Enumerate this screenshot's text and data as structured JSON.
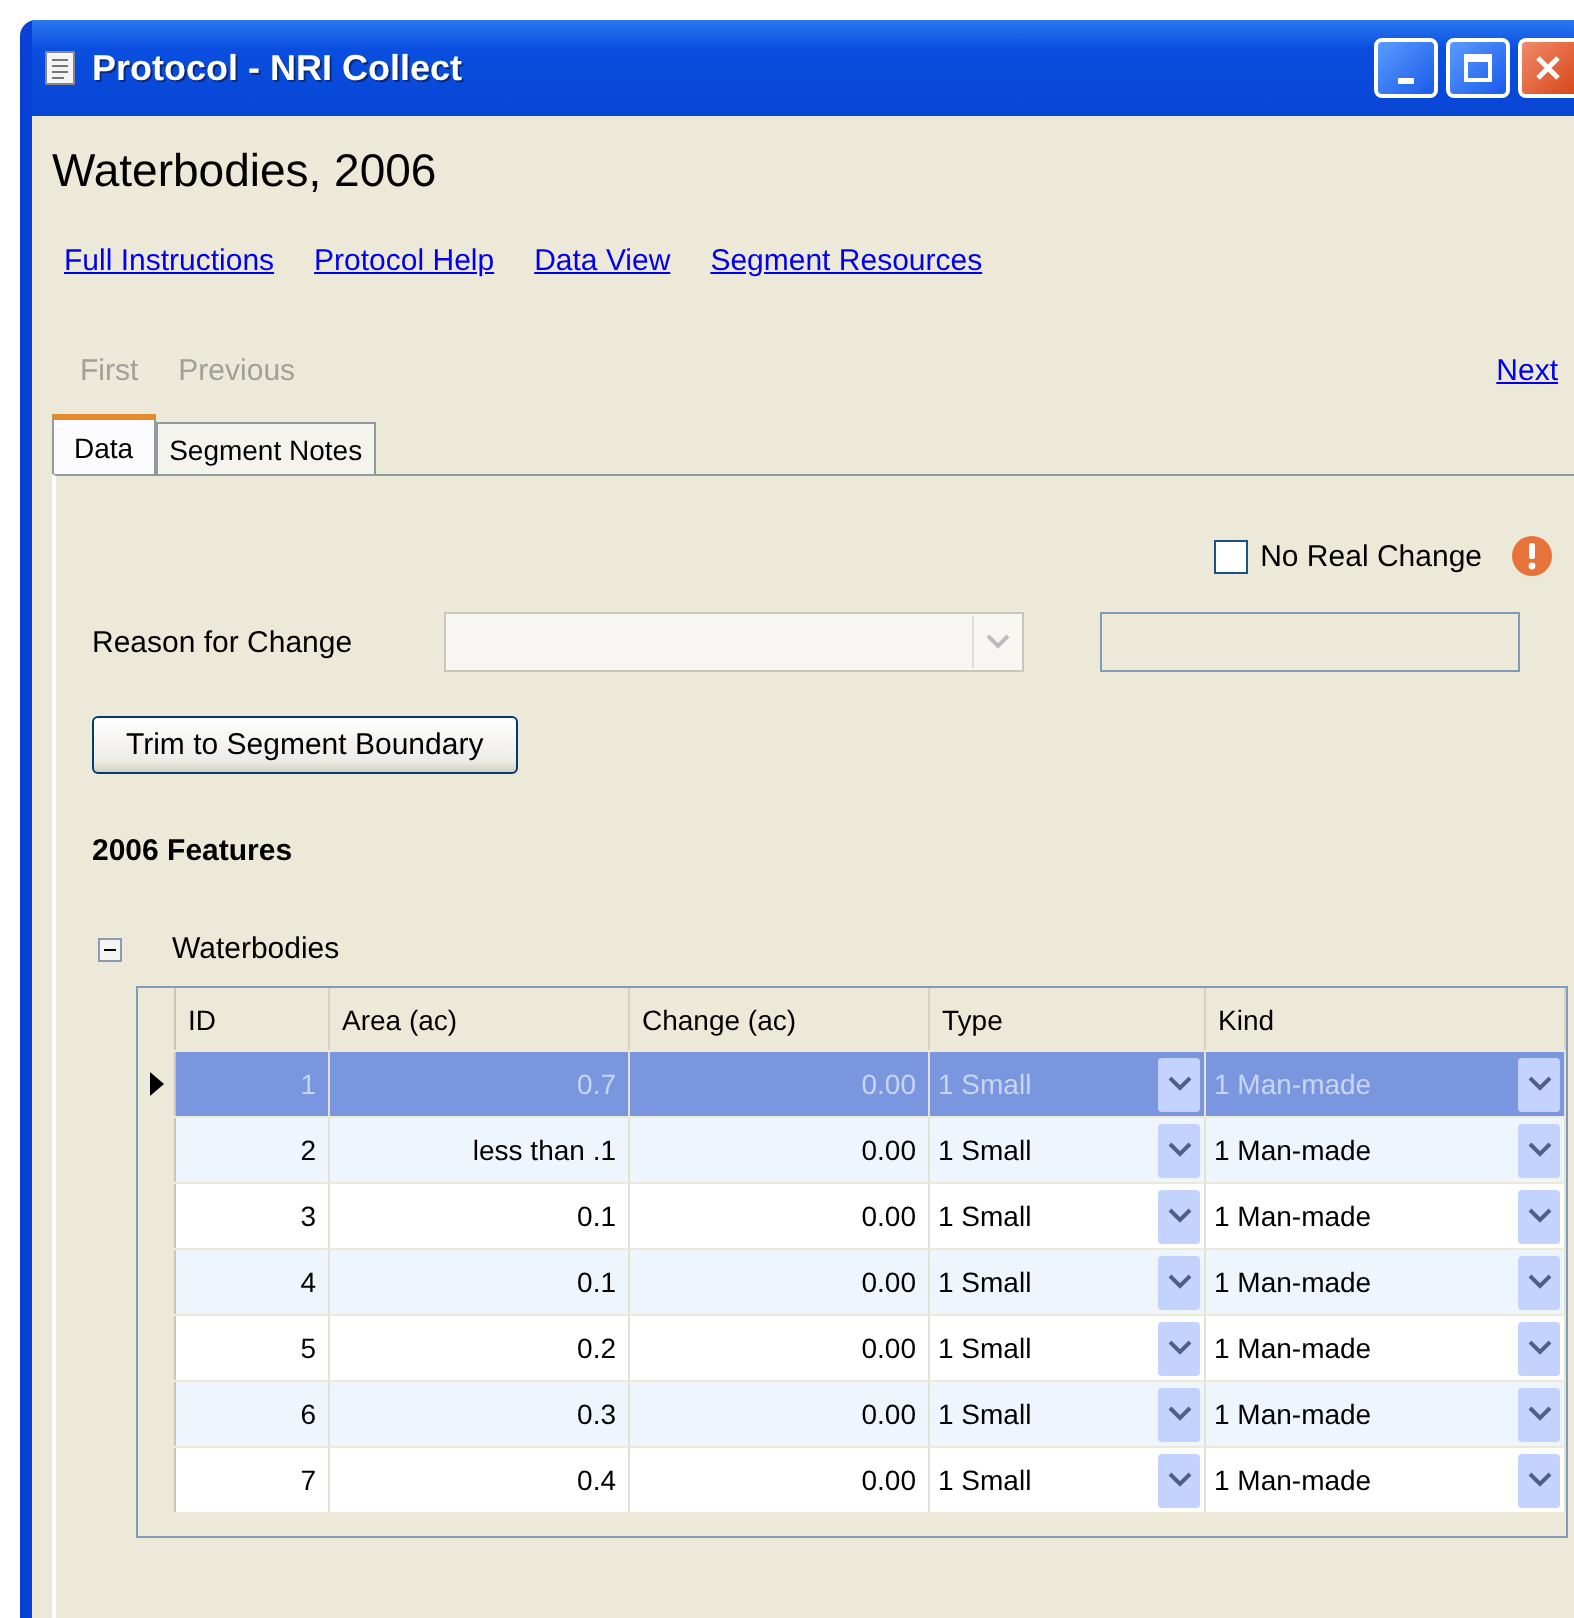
{
  "window": {
    "title": "Protocol - NRI Collect"
  },
  "heading": "Waterbodies, 2006",
  "links": [
    "Full Instructions",
    "Protocol Help",
    "Data View",
    "Segment Resources"
  ],
  "nav": [
    {
      "label": "First",
      "disabled": true
    },
    {
      "label": "Previous",
      "disabled": true
    },
    {
      "label": "Next",
      "disabled": false
    }
  ],
  "tabs": [
    {
      "label": "Data",
      "selected": true
    },
    {
      "label": "Segment Notes",
      "selected": false
    }
  ],
  "no_real_change": {
    "label": "No Real Change",
    "checked": false
  },
  "reason": {
    "label": "Reason for Change",
    "disabled": true
  },
  "trim_button": "Trim to Segment Boundary",
  "section_title": "2006 Features",
  "group": {
    "label": "Waterbodies",
    "expanded": true
  },
  "table": {
    "columns": [
      "ID",
      "Area (ac)",
      "Change (ac)",
      "Type",
      "Kind"
    ],
    "rows": [
      {
        "id": "1",
        "area": "0.7",
        "change": "0.00",
        "type": "1 Small",
        "kind": "1 Man-made",
        "selected": true
      },
      {
        "id": "2",
        "area": "less than .1",
        "change": "0.00",
        "type": "1 Small",
        "kind": "1 Man-made",
        "selected": false
      },
      {
        "id": "3",
        "area": "0.1",
        "change": "0.00",
        "type": "1 Small",
        "kind": "1 Man-made",
        "selected": false
      },
      {
        "id": "4",
        "area": "0.1",
        "change": "0.00",
        "type": "1 Small",
        "kind": "1 Man-made",
        "selected": false
      },
      {
        "id": "5",
        "area": "0.2",
        "change": "0.00",
        "type": "1 Small",
        "kind": "1 Man-made",
        "selected": false
      },
      {
        "id": "6",
        "area": "0.3",
        "change": "0.00",
        "type": "1 Small",
        "kind": "1 Man-made",
        "selected": false
      },
      {
        "id": "7",
        "area": "0.4",
        "change": "0.00",
        "type": "1 Small",
        "kind": "1 Man-made",
        "selected": false
      }
    ]
  }
}
